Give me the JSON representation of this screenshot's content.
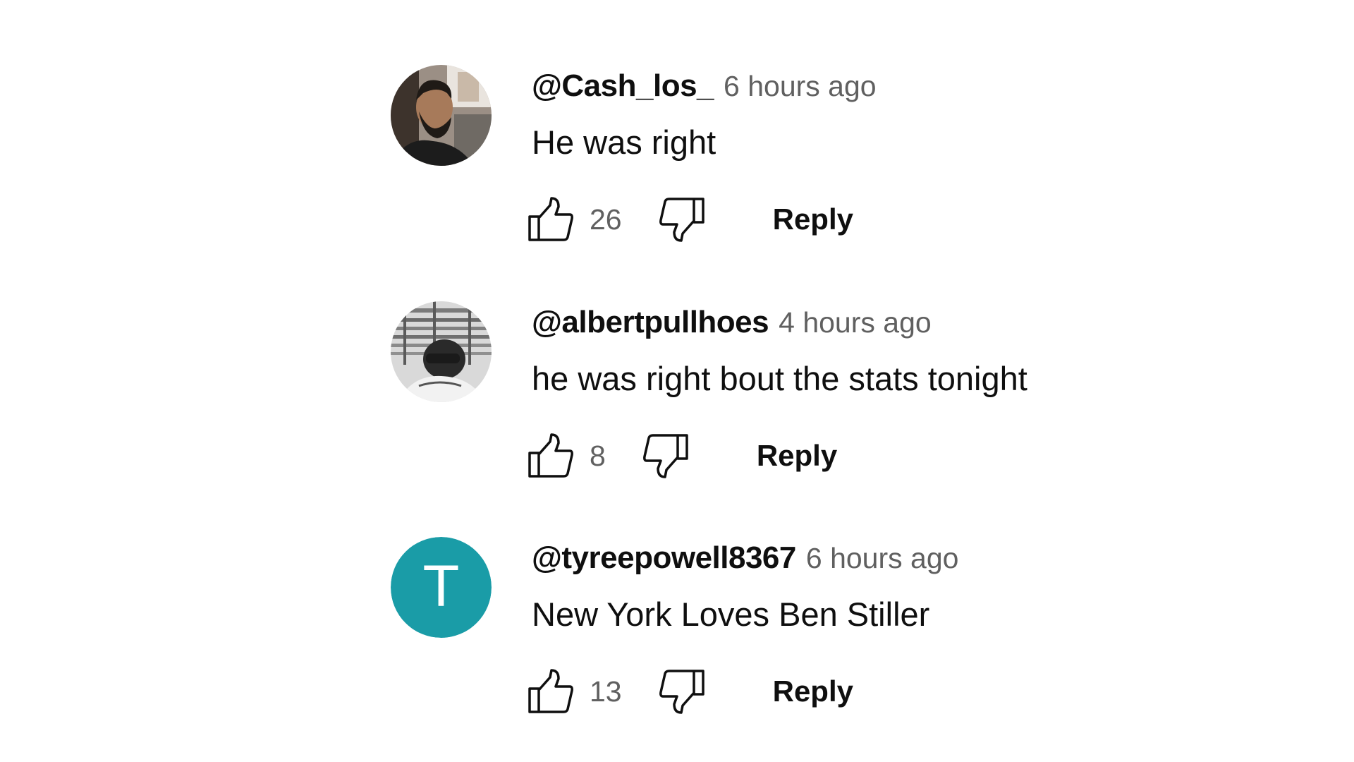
{
  "comments": [
    {
      "author": "@Cash_los_",
      "time": "6 hours ago",
      "text": "He was right",
      "likes": "26",
      "reply_label": "Reply",
      "avatar": {
        "type": "photo",
        "description_icon": "user-photo-icon"
      }
    },
    {
      "author": "@albertpullhoes",
      "time": "4 hours ago",
      "text": "he was right bout the stats tonight",
      "likes": "8",
      "reply_label": "Reply",
      "avatar": {
        "type": "photo",
        "description_icon": "user-photo-icon"
      }
    },
    {
      "author": "@tyreepowell8367",
      "time": "6 hours ago",
      "text": "New York Loves Ben Stiller",
      "likes": "13",
      "reply_label": "Reply",
      "avatar": {
        "type": "letter",
        "letter": "T",
        "color": "#1a9ca7"
      }
    }
  ],
  "icons": {
    "like": "thumbs-up-icon",
    "dislike": "thumbs-down-icon"
  }
}
